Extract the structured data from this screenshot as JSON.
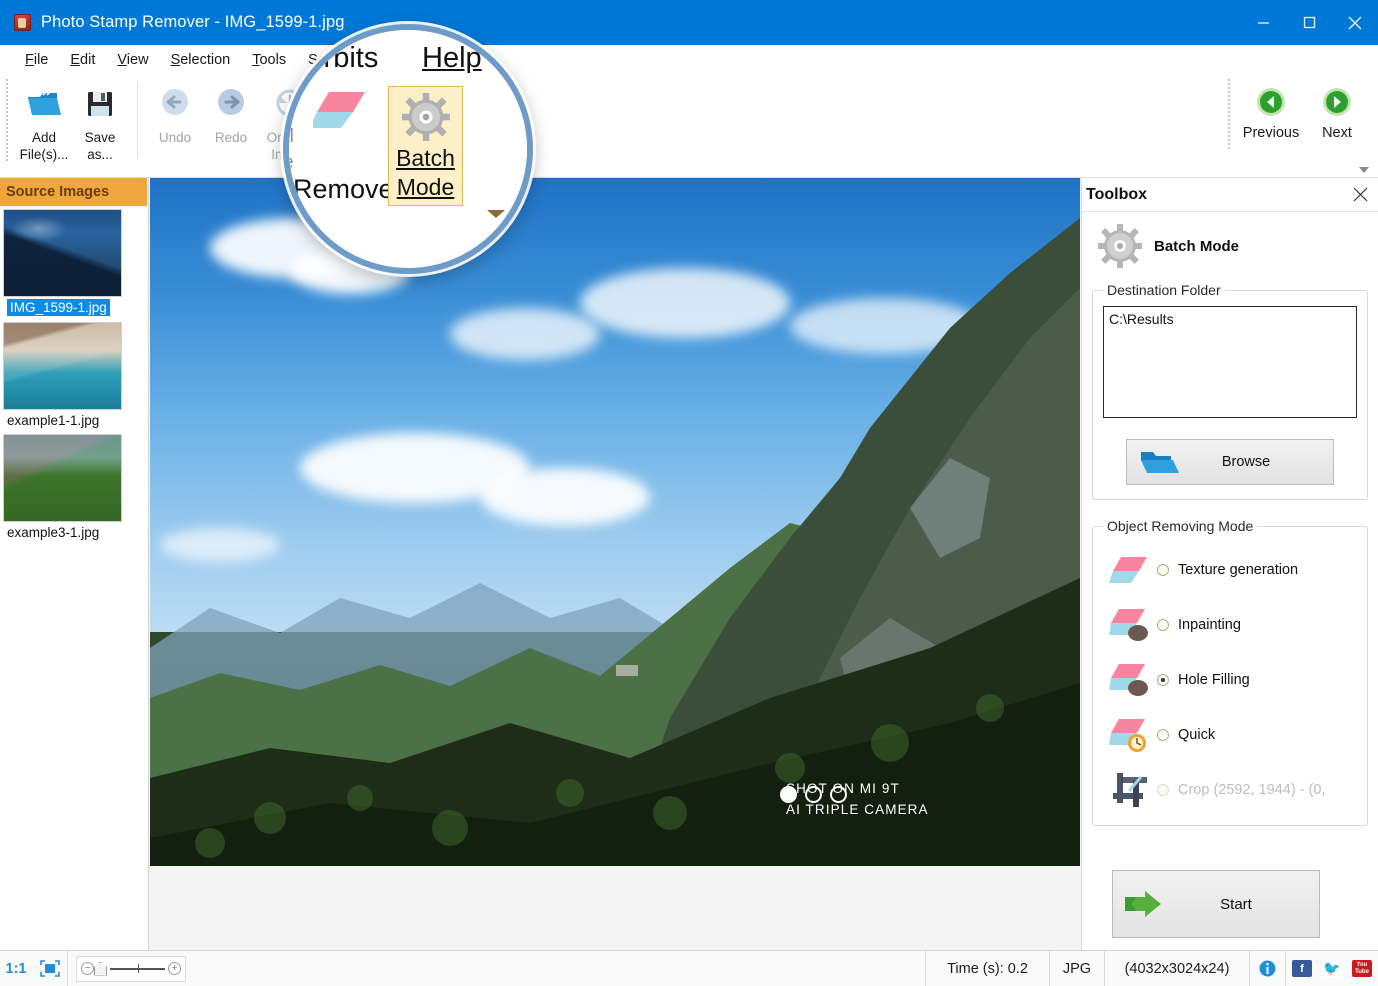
{
  "window": {
    "app_title": "Photo Stamp Remover - IMG_1599-1.jpg",
    "icon": "app-photo-icon",
    "minimize": "minimize-icon",
    "maximize": "maximize-icon",
    "close": "close-icon"
  },
  "menu": {
    "items": [
      {
        "label": "File",
        "accel": "F"
      },
      {
        "label": "Edit",
        "accel": "E"
      },
      {
        "label": "View",
        "accel": "V"
      },
      {
        "label": "Selection",
        "accel": "S"
      },
      {
        "label": "Tools",
        "accel": "T"
      },
      {
        "label": "Softorbits",
        "accel": "o"
      },
      {
        "label": "Help",
        "accel": "H"
      }
    ]
  },
  "toolbar": {
    "add_files": "Add File(s)...",
    "save_as": "Save as...",
    "undo": "Undo",
    "redo": "Redo",
    "original_image": "Original Image",
    "remove": "Remove",
    "batch_mode": "Batch Mode",
    "previous": "Previous",
    "next": "Next",
    "expand": "ribbon-expand-icon"
  },
  "magnifier": {
    "menu_partial": "Sof",
    "menu_orbits": "Orbits",
    "menu_help": "Help",
    "remove_label": "Remove",
    "batch_line1": "Batch",
    "batch_line2": "Mode",
    "left_frag_1": "al",
    "left_frag_2": "e"
  },
  "source_images": {
    "header": "Source Images",
    "items": [
      {
        "filename": "IMG_1599-1.jpg",
        "selected": true,
        "thumb": "mountain-blue-thumb"
      },
      {
        "filename": "example1-1.jpg",
        "selected": false,
        "thumb": "coast-cliff-thumb"
      },
      {
        "filename": "example3-1.jpg",
        "selected": false,
        "thumb": "fortress-green-thumb"
      }
    ]
  },
  "canvas": {
    "watermark_line1": "SHOT ON MI 9T",
    "watermark_line2": "AI TRIPLE CAMERA",
    "watermark_dots": 3
  },
  "toolbox": {
    "title": "Toolbox",
    "close": "close-icon",
    "mode_icon": "gear-icon",
    "mode_title": "Batch Mode",
    "destination": {
      "legend": "Destination Folder",
      "value": "C:\\Results",
      "placeholder": "",
      "browse_label": "Browse",
      "browse_icon": "folder-open-icon"
    },
    "object_removing_mode": {
      "legend": "Object Removing Mode",
      "options": [
        {
          "label": "Texture generation",
          "selected": false,
          "disabled": false,
          "icon": "eraser-icon"
        },
        {
          "label": "Inpainting",
          "selected": false,
          "disabled": false,
          "icon": "eraser-blob-icon"
        },
        {
          "label": "Hole Filling",
          "selected": true,
          "disabled": false,
          "icon": "eraser-blob-icon"
        },
        {
          "label": "Quick",
          "selected": false,
          "disabled": false,
          "icon": "eraser-clock-icon"
        },
        {
          "label": "Crop (2592, 1944) - (0,",
          "selected": false,
          "disabled": true,
          "icon": "crop-icon"
        }
      ]
    },
    "start_label": "Start",
    "start_icon": "green-arrow-icon"
  },
  "status_bar": {
    "zoom_ratio": "1:1",
    "fit_icon": "fit-to-screen-icon",
    "zoom_out": "−",
    "zoom_in": "+",
    "time": "Time (s): 0.2",
    "format": "JPG",
    "dimensions": "(4032x3024x24)",
    "info_icon": "info-icon",
    "facebook": "f",
    "twitter": "twitter-icon",
    "youtube": "You Tube"
  },
  "colors": {
    "titlebar": "#0078D7",
    "accent_orange": "#F0A63C",
    "selection_blue": "#0B8CE8",
    "batch_highlight": "#FDF0C8",
    "green": "#3E9B2E"
  }
}
